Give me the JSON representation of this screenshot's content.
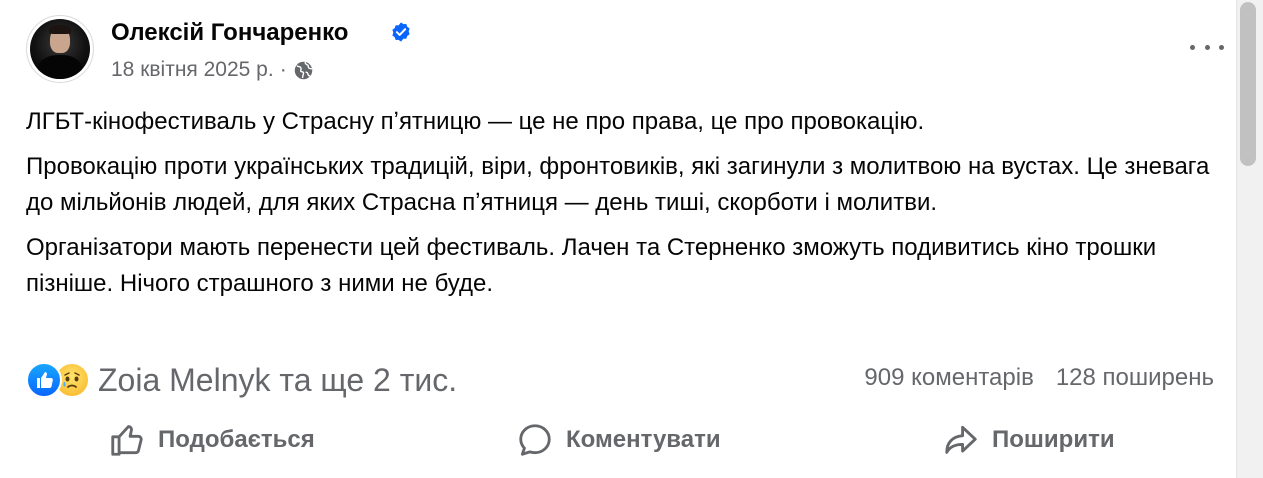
{
  "author": {
    "name": "Олексій Гончаренко",
    "verified_icon": "verified-badge-icon",
    "date": "18 квітня 2025 р.",
    "separator": "·",
    "audience_icon": "globe-icon"
  },
  "post": {
    "paragraphs": [
      "ЛГБТ-кінофестиваль у Страсну пʼятницю — це не про права, це про провокацію.",
      "Провокацію проти українських традицій, віри, фронтовиків, які загинули з молитвою на вустах. Це зневага до мільйонів людей, для яких Страсна пʼятниця — день тиші, скорботи і молитви.",
      "Організатори мають перенести цей фестиваль. Лачен та Стерненко зможуть подивитись кіно трошки пізніше. Нічого страшного з ними не буде."
    ]
  },
  "reactions": {
    "icons": [
      "like-reaction-icon",
      "sad-reaction-icon"
    ],
    "text": "Zoia Melnyk та ще 2 тис.",
    "comments": "909 коментарів",
    "shares": "128 поширень"
  },
  "actions": {
    "like": "Подобається",
    "comment": "Коментувати",
    "share": "Поширити"
  },
  "colors": {
    "secondary_text": "#65676b",
    "primary_text": "#050505",
    "verified_blue": "#0866ff"
  }
}
